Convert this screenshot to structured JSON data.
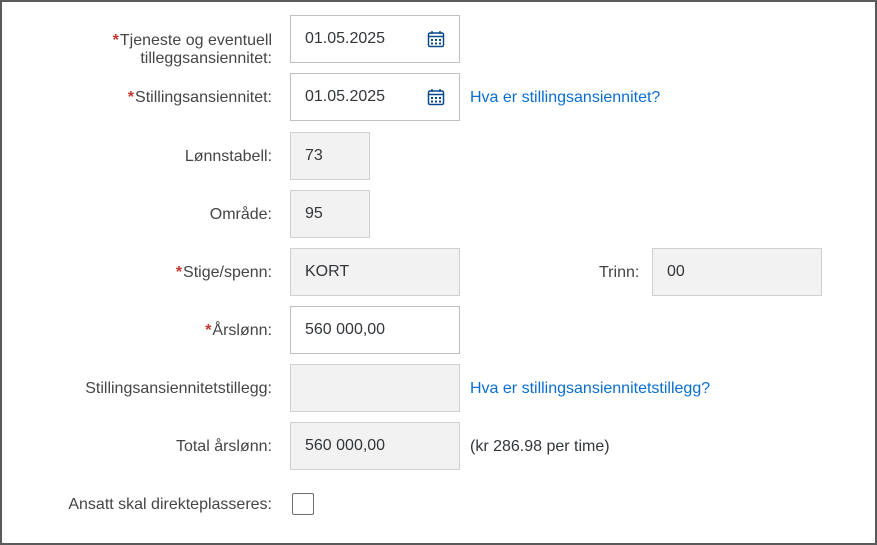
{
  "form": {
    "service_seniority": {
      "label": "Tjeneste og eventuell tilleggsansiennitet:",
      "label_line1": "Tjeneste og eventuell",
      "label_line2": "tilleggsansiennitet:",
      "value": "01.05.2025",
      "required": true
    },
    "position_seniority": {
      "label": "Stillingsansiennitet:",
      "value": "01.05.2025",
      "required": true,
      "help_link": "Hva er stillingsansiennitet?"
    },
    "salary_table": {
      "label": "Lønnstabell:",
      "value": "73"
    },
    "area": {
      "label": "Område:",
      "value": "95"
    },
    "ladder": {
      "label": "Stige/spenn:",
      "value": "KORT",
      "required": true
    },
    "step": {
      "label": "Trinn:",
      "value": "00"
    },
    "annual_salary": {
      "label": "Årslønn:",
      "value": "560 000,00",
      "required": true
    },
    "seniority_supplement": {
      "label": "Stillingsansiennitetstillegg:",
      "value": "",
      "help_link": "Hva er stillingsansiennitetstillegg?"
    },
    "total_salary": {
      "label": "Total årslønn:",
      "value": "560 000,00",
      "hourly_note": "(kr 286.98 per time)"
    },
    "direct_placement": {
      "label": "Ansatt skal direkteplasseres:",
      "checked": false
    }
  },
  "colors": {
    "required": "#c4352d",
    "link": "#0a6ed1",
    "readonly_bg": "#f2f2f2"
  },
  "icons": {
    "calendar": "calendar-icon"
  }
}
